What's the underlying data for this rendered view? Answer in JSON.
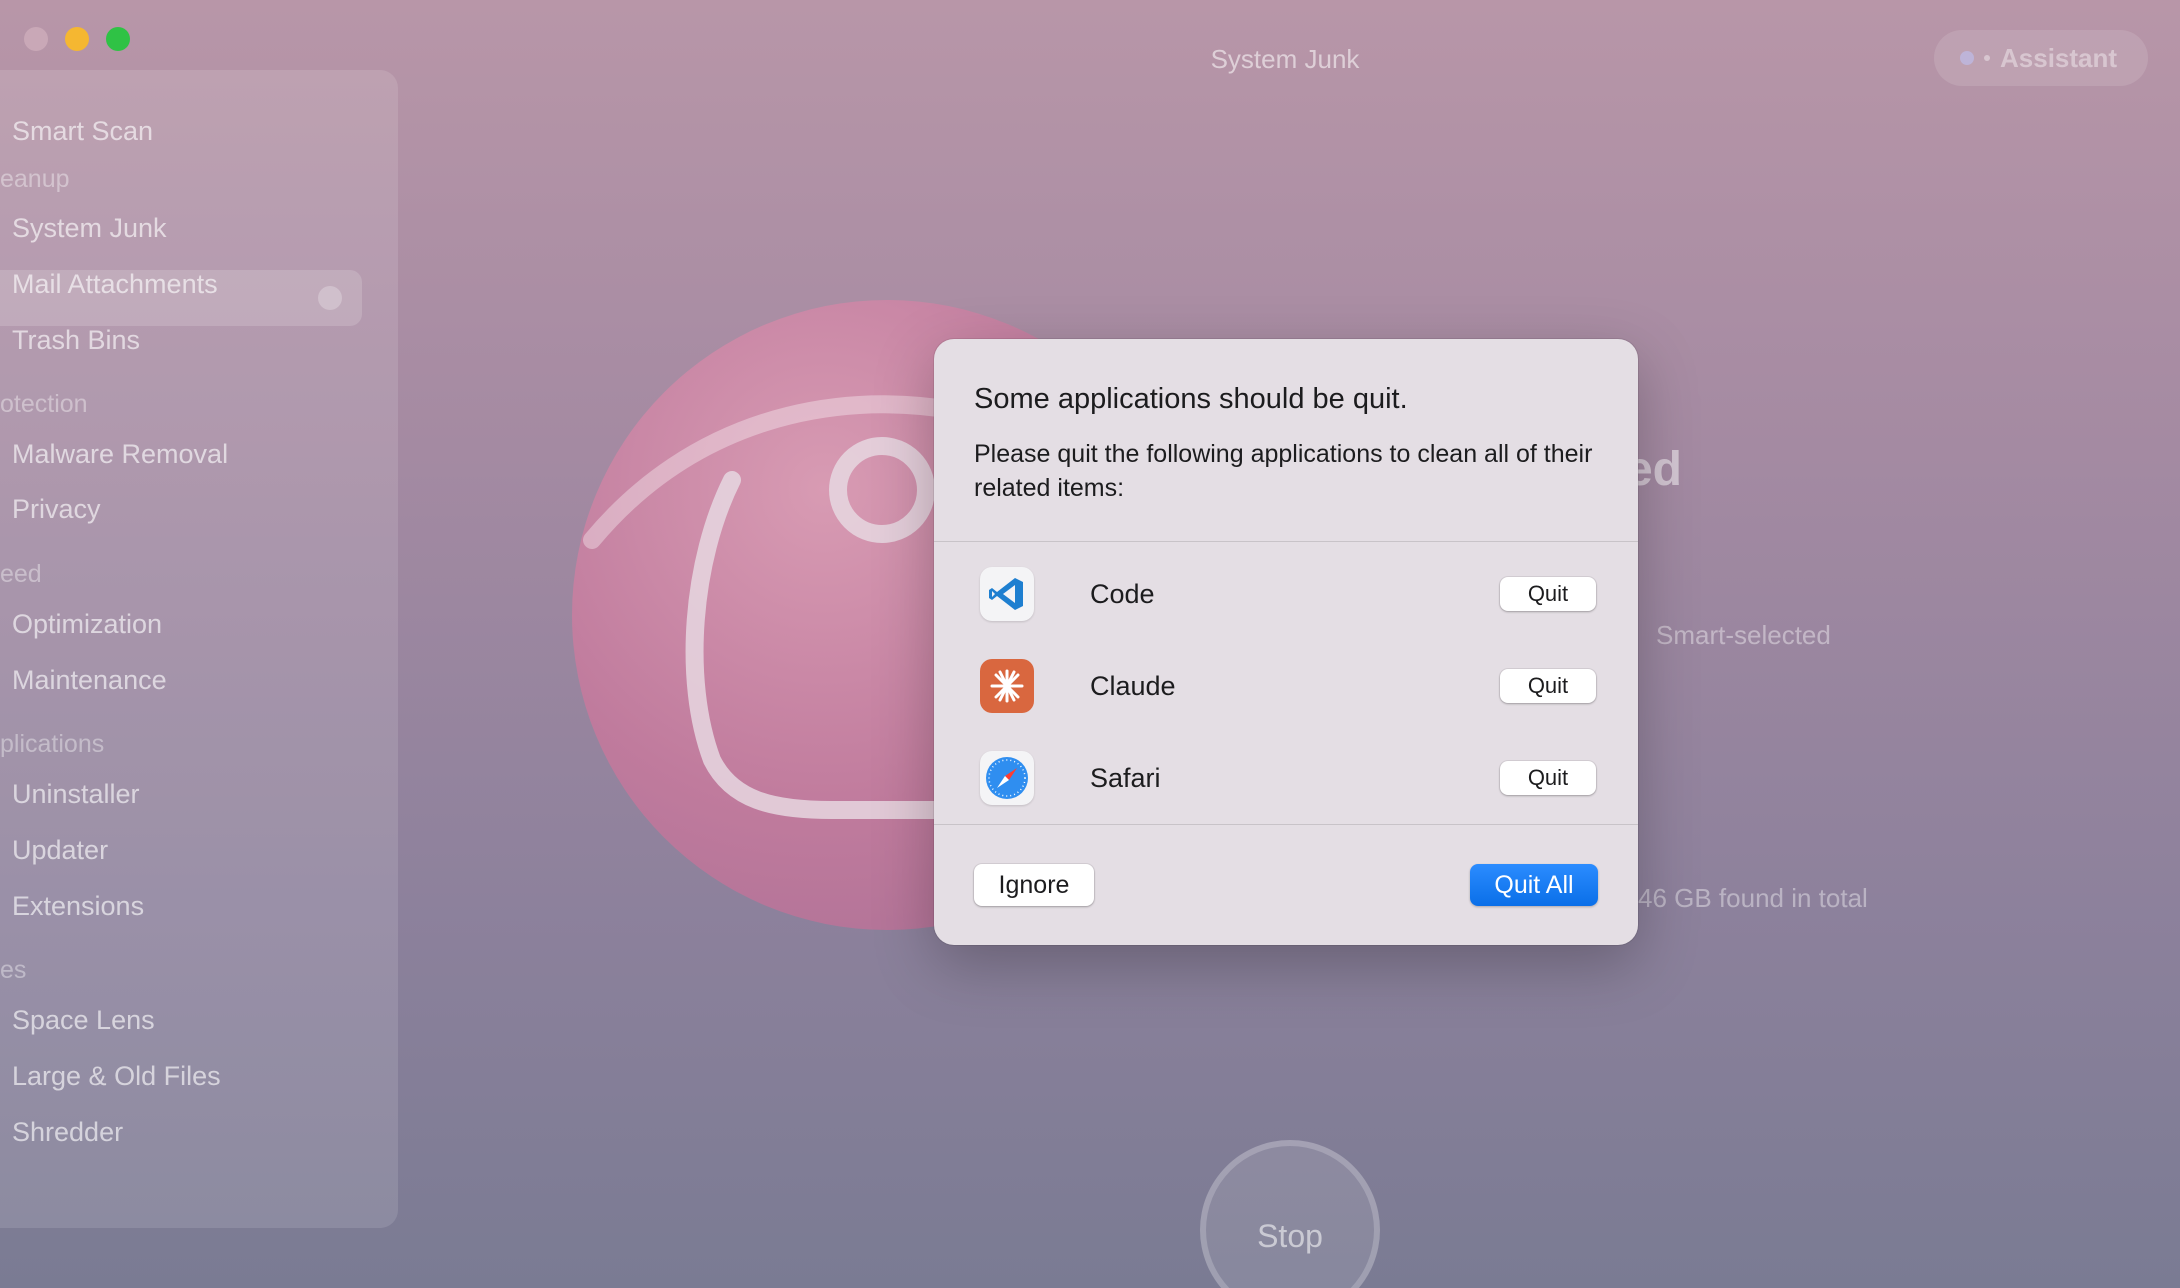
{
  "window": {
    "title": "System Junk",
    "assistant_label": "Assistant"
  },
  "sidebar": {
    "items": [
      {
        "label": "Smart Scan"
      },
      {
        "section": "eanup"
      },
      {
        "label": "System Junk",
        "selected": true
      },
      {
        "label": "Mail Attachments"
      },
      {
        "label": "Trash Bins"
      },
      {
        "section": "otection"
      },
      {
        "label": "Malware Removal"
      },
      {
        "label": "Privacy"
      },
      {
        "section": "eed"
      },
      {
        "label": "Optimization"
      },
      {
        "label": "Maintenance"
      },
      {
        "section": "plications"
      },
      {
        "label": "Uninstaller"
      },
      {
        "label": "Updater"
      },
      {
        "label": "Extensions"
      },
      {
        "section": "es"
      },
      {
        "label": "Space Lens"
      },
      {
        "label": "Large & Old Files"
      },
      {
        "label": "Shredder"
      }
    ]
  },
  "background": {
    "heading_fragment": "ted",
    "smart_selected": "Smart-selected",
    "found_total": "46 GB found in total",
    "stop_label": "Stop"
  },
  "dialog": {
    "title": "Some applications should be quit.",
    "message": "Please quit the following applications to clean all of their related items:",
    "apps": [
      {
        "name": "Code",
        "icon": "vscode-icon",
        "button": "Quit"
      },
      {
        "name": "Claude",
        "icon": "claude-icon",
        "button": "Quit"
      },
      {
        "name": "Safari",
        "icon": "safari-icon",
        "button": "Quit"
      }
    ],
    "ignore_label": "Ignore",
    "quit_all_label": "Quit All"
  },
  "colors": {
    "accent": "#0a6fe8",
    "claude_icon_bg": "#d9673f",
    "vscode_blue": "#1e7fd0"
  }
}
